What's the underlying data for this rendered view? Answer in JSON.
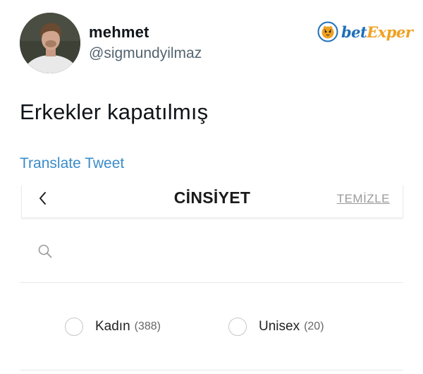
{
  "tweet": {
    "display_name": "mehmet",
    "handle": "@sigmundyilmaz",
    "text": "Erkekler kapatılmış",
    "translate_label": "Translate Tweet"
  },
  "watermark": {
    "brand_part1": "bet",
    "brand_part2": "Exper",
    "colors": {
      "bet": "#1f6fb8",
      "exper": "#f0a020"
    }
  },
  "filter_panel": {
    "back_icon": "chevron-left-icon",
    "title": "CİNSİYET",
    "clear_label": "TEMİZLE",
    "search": {
      "icon": "search-icon",
      "value": "",
      "placeholder": ""
    },
    "options": [
      {
        "label": "Kadın",
        "count": "(388)",
        "selected": false
      },
      {
        "label": "Unisex",
        "count": "(20)",
        "selected": false
      }
    ]
  },
  "colors": {
    "text_primary": "#0f1419",
    "text_secondary": "#536471",
    "link": "#3b8cc9",
    "divider": "#e8e8e8"
  }
}
